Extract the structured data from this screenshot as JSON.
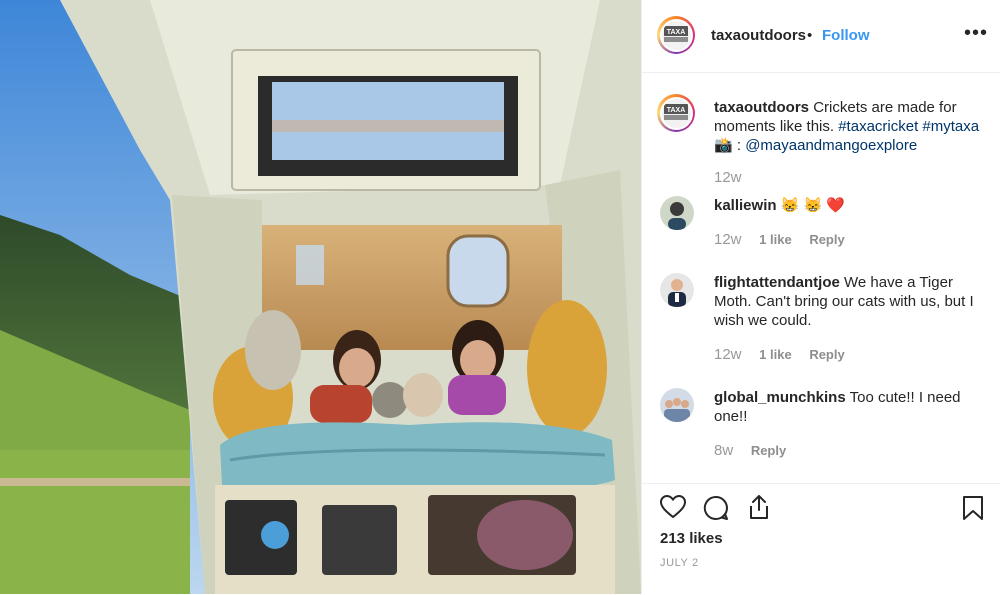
{
  "post": {
    "username": "taxaoutdoors",
    "separator": "•",
    "follow_label": "Follow",
    "more_label": "•••",
    "caption": {
      "username": "taxaoutdoors",
      "text": "Crickets are made for moments like this.",
      "tags": "#taxacricket #mytaxa",
      "camera_emoji": "📸",
      "credit_sep": ":",
      "credit": "@mayaandmangoexplore",
      "time": "12w"
    },
    "comments": [
      {
        "username": "kalliewin",
        "text": "😸 😸 ❤️",
        "time": "12w",
        "likes": "1 like",
        "reply": "Reply"
      },
      {
        "username": "flightattendantjoe",
        "text": "We have a Tiger Moth. Can't bring our cats with us, but I wish we could.",
        "time": "12w",
        "likes": "1 like",
        "reply": "Reply"
      },
      {
        "username": "global_munchkins",
        "text": "Too cute!! I need one!!",
        "time": "8w",
        "reply": "Reply"
      }
    ],
    "likes": "213 likes",
    "date": "JULY 2",
    "logo_text": "TAXA"
  },
  "icons": [
    "heart-icon",
    "comment-icon",
    "share-icon",
    "bookmark-icon",
    "more-icon"
  ],
  "colors": {
    "link": "#3897f0",
    "hashtag": "#003569",
    "muted": "#8e8e8e"
  }
}
